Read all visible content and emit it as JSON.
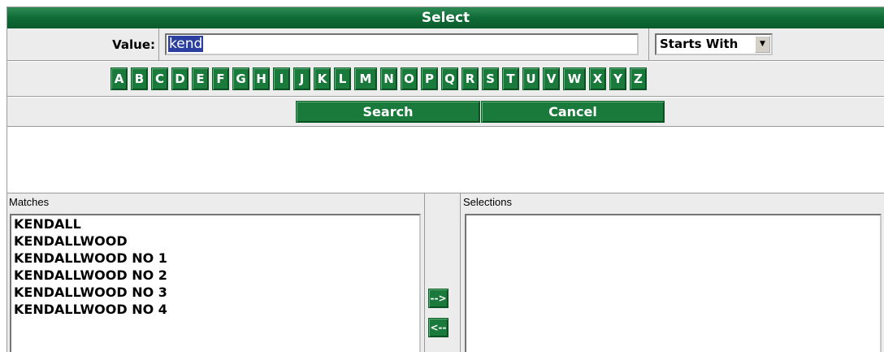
{
  "title": "Select",
  "value_row": {
    "label": "Value:",
    "input_value": "kend",
    "match_mode": "Starts With"
  },
  "letters": [
    "A",
    "B",
    "C",
    "D",
    "E",
    "F",
    "G",
    "H",
    "I",
    "J",
    "K",
    "L",
    "M",
    "N",
    "O",
    "P",
    "Q",
    "R",
    "S",
    "T",
    "U",
    "V",
    "W",
    "X",
    "Y",
    "Z"
  ],
  "buttons": {
    "search": "Search",
    "cancel": "Cancel"
  },
  "matches": {
    "label": "Matches",
    "items": [
      "KENDALL",
      "KENDALLWOOD",
      "KENDALLWOOD NO 1",
      "KENDALLWOOD NO 2",
      "KENDALLWOOD NO 3",
      "KENDALLWOOD NO 4"
    ]
  },
  "selections": {
    "label": "Selections",
    "items": []
  },
  "transfer": {
    "add": "-->",
    "remove": "<--"
  },
  "colors": {
    "accent_green": "#1a7a3c",
    "panel_gray": "#ececec"
  }
}
